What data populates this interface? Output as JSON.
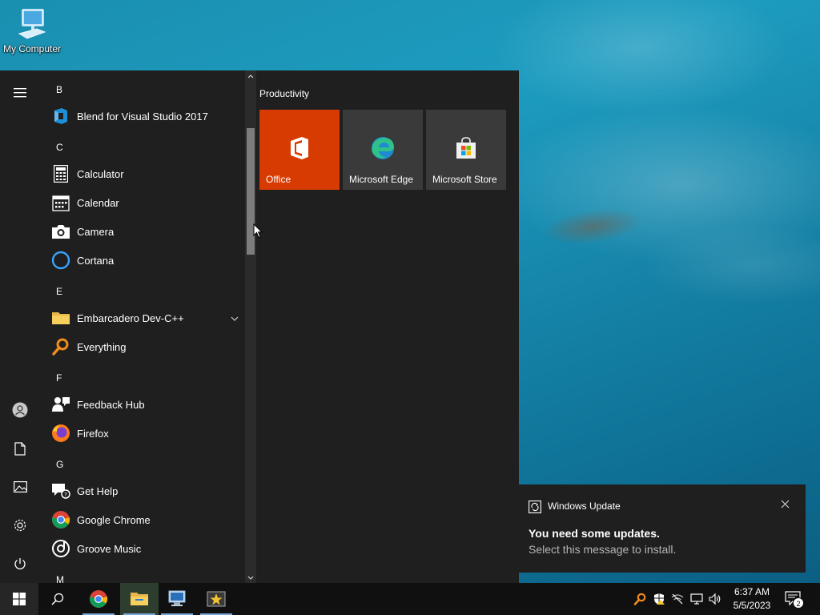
{
  "desktop": {
    "icons": [
      {
        "label": "My Computer",
        "icon": "monitor-icon"
      }
    ]
  },
  "start_menu": {
    "rail": [
      "hamburger-icon",
      "user-icon",
      "documents-icon",
      "pictures-icon",
      "settings-icon",
      "power-icon"
    ],
    "letters": [
      "B",
      "C",
      "E",
      "F",
      "G",
      "M"
    ],
    "apps": [
      {
        "name": "Blend for Visual Studio 2017",
        "icon": "blend-icon"
      },
      {
        "name": "Calculator",
        "icon": "calculator-icon"
      },
      {
        "name": "Calendar",
        "icon": "calendar-icon"
      },
      {
        "name": "Camera",
        "icon": "camera-icon"
      },
      {
        "name": "Cortana",
        "icon": "cortana-icon"
      },
      {
        "name": "Embarcadero Dev-C++",
        "icon": "folder-icon",
        "expandable": true
      },
      {
        "name": "Everything",
        "icon": "everything-search-icon"
      },
      {
        "name": "Feedback Hub",
        "icon": "feedback-icon"
      },
      {
        "name": "Firefox",
        "icon": "firefox-icon"
      },
      {
        "name": "Get Help",
        "icon": "help-icon"
      },
      {
        "name": "Google Chrome",
        "icon": "chrome-icon"
      },
      {
        "name": "Groove Music",
        "icon": "groove-icon"
      }
    ],
    "tiles_group": "Productivity",
    "tiles": [
      {
        "label": "Office",
        "icon": "office-icon",
        "color": "#d83b01"
      },
      {
        "label": "Microsoft Edge",
        "icon": "edge-icon",
        "color": "#3a3a3a"
      },
      {
        "label": "Microsoft Store",
        "icon": "store-icon",
        "color": "#3a3a3a"
      }
    ]
  },
  "toast": {
    "app_name": "Windows Update",
    "headline": "You need some updates.",
    "body": "Select this message to install."
  },
  "taskbar": {
    "pinned": [
      "start-icon",
      "search-icon",
      "chrome-icon",
      "file-explorer-icon",
      "remote-desktop-icon",
      "star-app-icon"
    ],
    "tray": [
      "everything-tray-icon",
      "defender-icon",
      "network-disconnected-icon",
      "display-icon",
      "volume-icon"
    ],
    "time": "6:37 AM",
    "date": "5/5/2023",
    "notification_count": "2"
  },
  "colors": {
    "accent": "#0078d7",
    "menu_bg": "#1f1f1f",
    "office": "#d83b01"
  }
}
